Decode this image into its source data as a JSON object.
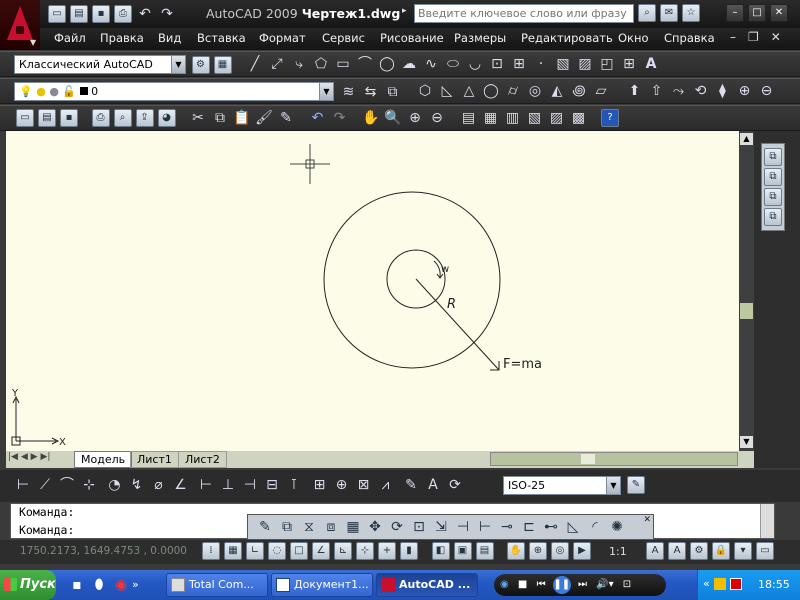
{
  "window": {
    "title_app": "AutoCAD 2009",
    "title_doc": "Чертеж1.dwg",
    "search_placeholder": "Введите ключевое слово или фразу"
  },
  "menu": [
    "Файл",
    "Правка",
    "Вид",
    "Вставка",
    "Формат",
    "Сервис",
    "Рисование",
    "Размеры",
    "Редактировать",
    "Окно",
    "Справка"
  ],
  "toolbar": {
    "workspace": "Классический AutoCAD",
    "layer": "0"
  },
  "drawing": {
    "label_w": "w",
    "label_r": "R",
    "label_f": "F=ma",
    "ucs_x": "X",
    "ucs_y": "Y"
  },
  "tabs": [
    "Модель",
    "Лист1",
    "Лист2"
  ],
  "dimstyle": "ISO-25",
  "command": {
    "line1": "Команда:",
    "line2": "Команда:"
  },
  "status": {
    "coords": "1750.2173, 1649.4753 , 0.0000",
    "scale": "1:1"
  },
  "taskbar": {
    "start": "Пуск",
    "tasks": [
      "Total Com...",
      "Документ1...",
      "AutoCAD ..."
    ],
    "clock": "18:55"
  },
  "colors": {
    "accent_red": "#c8102e",
    "canvas_bg": "#fdfce9",
    "taskbar_blue": "#2459c4"
  }
}
